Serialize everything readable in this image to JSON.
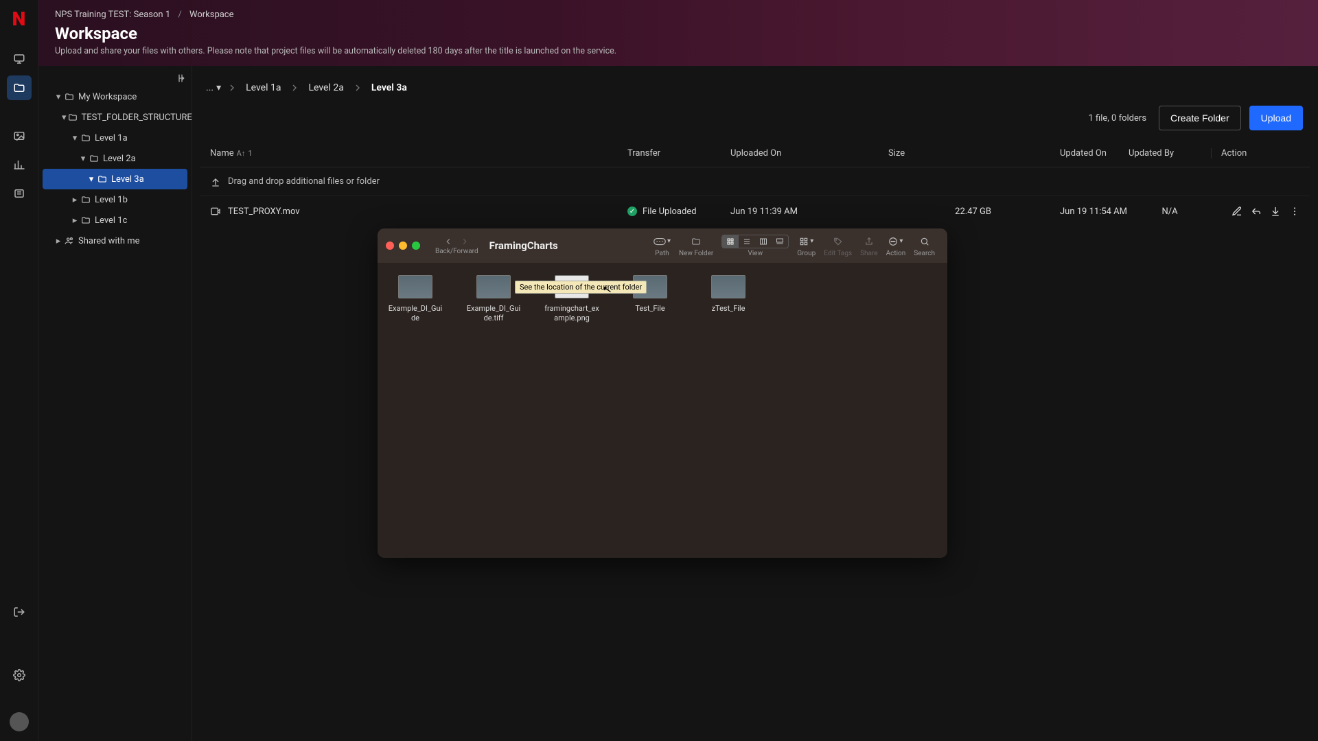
{
  "breadcrumb": {
    "root": "NPS Training TEST: Season 1",
    "current": "Workspace"
  },
  "page": {
    "title": "Workspace",
    "subtitle": "Upload and share your files with others. Please note that project files will be automatically deleted 180 days after the title is launched on the service."
  },
  "tree": {
    "my_workspace": "My Workspace",
    "test_folder": "TEST_FOLDER_STRUCTURE",
    "l1a": "Level 1a",
    "l2a": "Level 2a",
    "l3a": "Level 3a",
    "l1b": "Level 1b",
    "l1c": "Level 1c",
    "shared": "Shared with me"
  },
  "path": {
    "ellipsis": "...",
    "seg1": "Level 1a",
    "seg2": "Level 2a",
    "seg3": "Level 3a"
  },
  "actions": {
    "file_count": "1 file, 0 folders",
    "create_folder": "Create Folder",
    "upload": "Upload"
  },
  "table": {
    "cols": {
      "name": "Name",
      "sort_badge": "1",
      "transfer": "Transfer",
      "uploaded_on": "Uploaded On",
      "size": "Size",
      "updated_on": "Updated On",
      "updated_by": "Updated By",
      "action": "Action"
    },
    "dropzone": "Drag and drop additional files or folder",
    "row": {
      "name": "TEST_PROXY.mov",
      "transfer_status": "File Uploaded",
      "uploaded_on": "Jun 19 11:39 AM",
      "size": "22.47 GB",
      "updated_on": "Jun 19 11:54 AM",
      "updated_by": "N/A"
    }
  },
  "finder": {
    "title": "FramingCharts",
    "nav_label": "Back/Forward",
    "tools": {
      "path": "Path",
      "new_folder": "New Folder",
      "view": "View",
      "group": "Group",
      "edit_tags": "Edit Tags",
      "share": "Share",
      "action": "Action",
      "search": "Search"
    },
    "tooltip": "See the location of the current folder",
    "items": [
      "Example_DI_Guide",
      "Example_DI_Guide.tiff",
      "framingchart_example.png",
      "Test_File",
      "zTest_File"
    ]
  }
}
